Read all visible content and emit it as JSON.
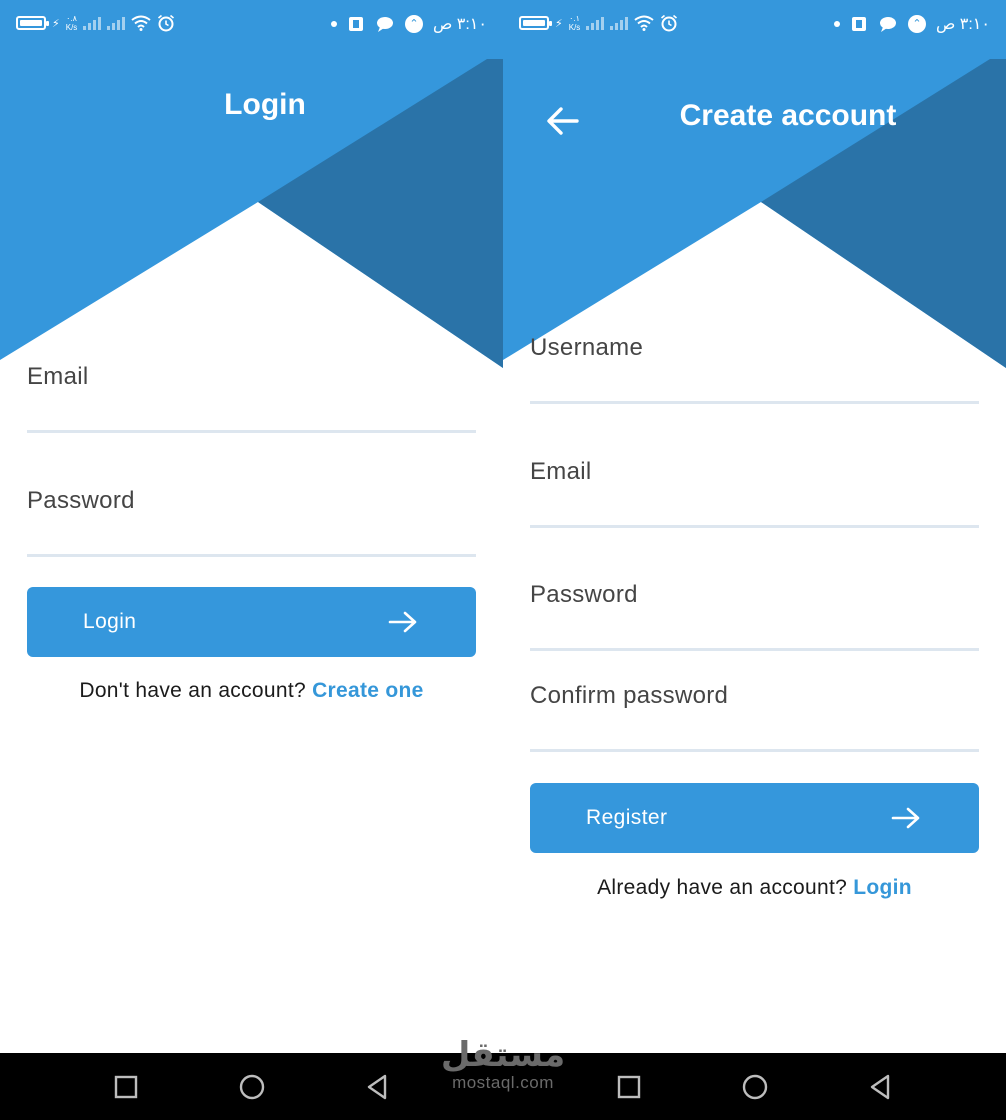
{
  "colors": {
    "primary": "#3597dc",
    "primary_dark": "#2a73a8",
    "field_underline": "#dde6ef",
    "link": "#3597d9",
    "nav_bar": "#000000"
  },
  "status_bar": {
    "net_speed_value": "٠.٨",
    "net_speed_value_register": "٠.١",
    "net_speed_unit": "K/s",
    "time": "٣:١٠ ص",
    "battery_level": 1.0,
    "icons": [
      "battery-icon",
      "charging-bolt-icon",
      "signal-icon",
      "wifi-icon",
      "alarm-icon",
      "dot-icon",
      "sim-icon",
      "chat-icon",
      "app-badge-icon"
    ]
  },
  "login_screen": {
    "title": "Login",
    "email_label": "Email",
    "password_label": "Password",
    "login_button_label": "Login",
    "login_button_icon": "arrow-right-icon",
    "footer_text": "Don't have an account? ",
    "footer_link": "Create one"
  },
  "register_screen": {
    "title": "Create account",
    "back_icon": "arrow-left-icon",
    "username_label": "Username",
    "email_label": "Email",
    "password_label": "Password",
    "confirm_password_label": "Confirm password",
    "register_button_label": "Register",
    "register_button_icon": "arrow-right-icon",
    "footer_text": "Already have an account? ",
    "footer_link": "Login"
  },
  "nav_bar": {
    "icons": [
      "recent-apps-icon",
      "home-icon",
      "back-icon"
    ]
  },
  "watermark": {
    "script": "مستقل",
    "domain": "mostaql.com"
  }
}
